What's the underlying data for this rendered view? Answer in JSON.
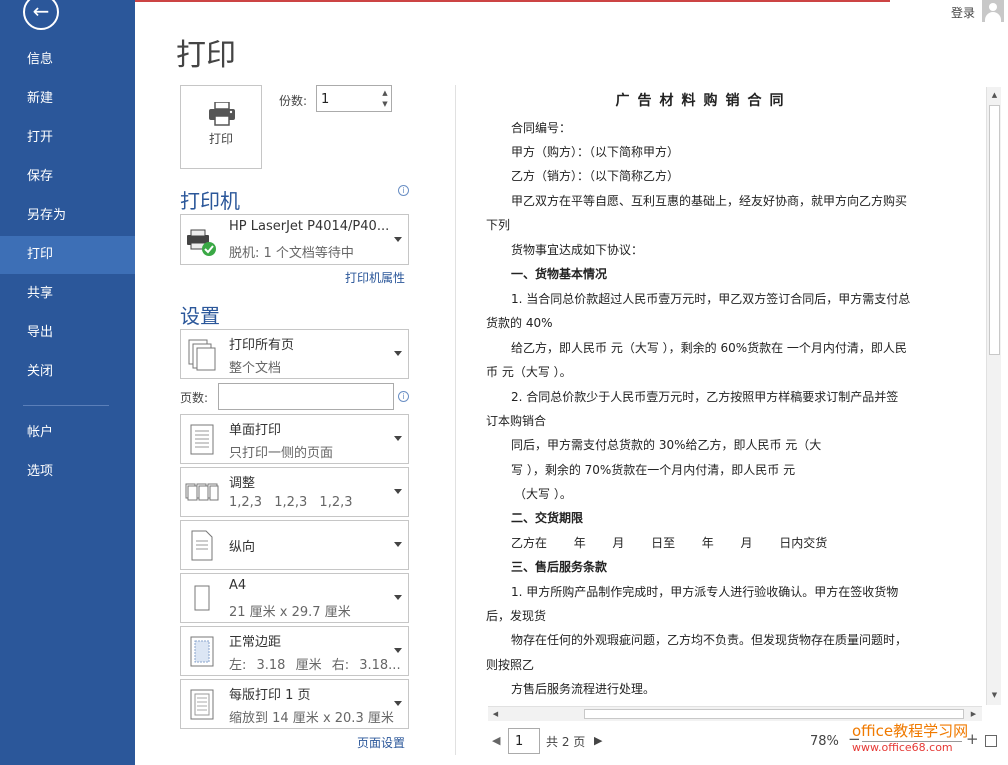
{
  "nav": {
    "items": [
      {
        "label": "信息"
      },
      {
        "label": "新建"
      },
      {
        "label": "打开"
      },
      {
        "label": "保存"
      },
      {
        "label": "另存为"
      },
      {
        "label": "打印"
      },
      {
        "label": "共享"
      },
      {
        "label": "导出"
      },
      {
        "label": "关闭"
      },
      {
        "label": "帐户"
      },
      {
        "label": "选项"
      }
    ],
    "active": "打印"
  },
  "header": {
    "login": "登录",
    "title": "打印"
  },
  "print_button": {
    "label": "打印"
  },
  "copies": {
    "label": "份数:",
    "value": "1"
  },
  "printer": {
    "section_title": "打印机",
    "name": "HP LaserJet P4014/P40...",
    "status": "脱机: 1 个文档等待中",
    "properties_link": "打印机属性"
  },
  "settings": {
    "section_title": "设置",
    "range": {
      "line1": "打印所有页",
      "line2": "整个文档"
    },
    "pages_label": "页数:",
    "pages_value": "",
    "sides": {
      "line1": "单面打印",
      "line2": "只打印一侧的页面"
    },
    "collate": {
      "line1": "调整",
      "line2": "1,2,3 1,2,3 1,2,3"
    },
    "orientation": {
      "line1": "纵向"
    },
    "paper": {
      "line1": "A4",
      "line2": "21 厘米 x 29.7 厘米"
    },
    "margins": {
      "line1": "正常边距",
      "line2": "左: 3.18 厘米 右: 3.18..."
    },
    "pages_per_sheet": {
      "line1": "每版打印 1 页",
      "line2": "缩放到 14 厘米 x 20.3 厘米"
    },
    "page_setup_link": "页面设置"
  },
  "preview": {
    "title": "广告材料购销合同",
    "lines": [
      "合同编号：",
      "甲方（购方）：（以下简称甲方）",
      "乙方（销方）：（以下简称乙方）",
      "甲乙双方在平等自愿、互利互惠的基础上，经友好协商，就甲方向乙方购买",
      "下列",
      "货物事宜达成如下协议：",
      "一、货物基本情况",
      "1. 当合同总价款超过人民币壹万元时，甲乙双方签订合同后，甲方需支付总",
      "货款的 40%",
      "给乙方，即人民币  元（大写  ），剩余的 60%货款在  一个月内付清，即人民",
      "币  元（大写  ）。",
      "2. 合同总价款少于人民币壹万元时，乙方按照甲方样稿要求订制产品并签",
      "订本购销合",
      "同后，甲方需支付总货款的 30%给乙方，即人民币  元（大",
      "写  ），剩余的 70%货款在一个月内付清，即人民币  元",
      "（大写  ）。",
      "二、交货期限",
      "乙方在       年       月       日至       年       月       日内交货",
      "三、售后服务条款",
      "1. 甲方所购产品制作完成时，甲方派专人进行验收确认。甲方在签收货物",
      "后，发现货",
      "物存在任何的外观瑕疵问题，乙方均不负责。但发现货物存在质量问题时，",
      "则按照乙",
      "方售后服务流程进行处理。"
    ]
  },
  "footer": {
    "page_num": "1",
    "total_pages": "共 2 页",
    "zoom": "78%",
    "minus": "−",
    "plus": "+"
  },
  "watermark": {
    "line1": "office教程学习网",
    "line2": "www.office68.com"
  },
  "colors": {
    "nav_bg": "#2b579a",
    "nav_active": "#3d6fb6",
    "accent": "#2b579a",
    "watermark_orange": "#f07a00",
    "watermark_red": "#e53935"
  }
}
